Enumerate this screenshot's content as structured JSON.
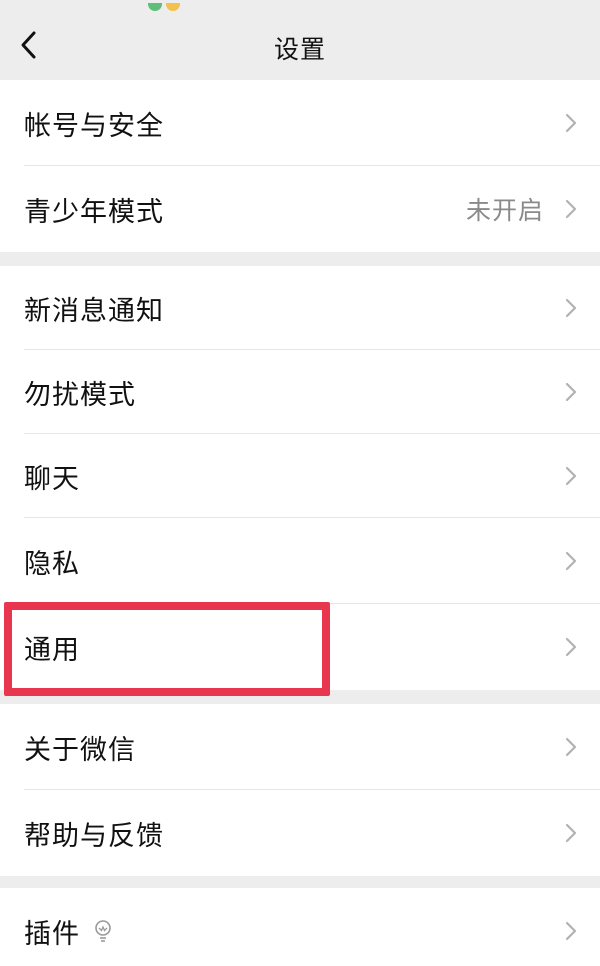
{
  "header": {
    "title": "设置",
    "back_icon": "chevron-left-icon"
  },
  "groups": [
    {
      "items": [
        {
          "label": "帐号与安全",
          "value": ""
        },
        {
          "label": "青少年模式",
          "value": "未开启"
        }
      ]
    },
    {
      "items": [
        {
          "label": "新消息通知",
          "value": ""
        },
        {
          "label": "勿扰模式",
          "value": ""
        },
        {
          "label": "聊天",
          "value": ""
        },
        {
          "label": "隐私",
          "value": ""
        },
        {
          "label": "通用",
          "value": "",
          "highlighted": true
        }
      ]
    },
    {
      "items": [
        {
          "label": "关于微信",
          "value": ""
        },
        {
          "label": "帮助与反馈",
          "value": ""
        }
      ]
    },
    {
      "items": [
        {
          "label": "插件",
          "value": "",
          "icon": "lightbulb-icon"
        }
      ]
    }
  ],
  "colors": {
    "background": "#ededed",
    "row": "#ffffff",
    "highlight_border": "#e8364e",
    "chevron": "#b2b2b2",
    "secondary_text": "#8a8a8a"
  }
}
